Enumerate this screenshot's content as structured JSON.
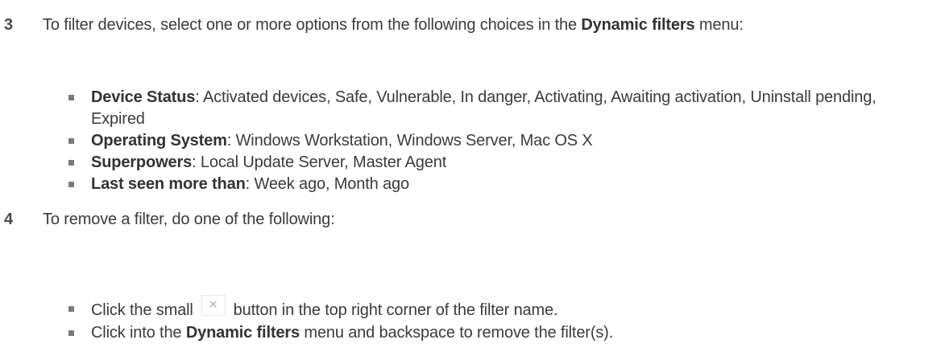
{
  "step3": {
    "number": "3",
    "intro_before": "To filter devices, select one or more options from the following choices in the ",
    "intro_bold": "Dynamic filters",
    "intro_after": " menu:",
    "bullets": [
      {
        "label": "Device Status",
        "text": ": Activated devices, Safe, Vulnerable, In danger, Activating, Awaiting activation, Uninstall pending, Expired"
      },
      {
        "label": "Operating System",
        "text": ": Windows Workstation, Windows Server, Mac OS X"
      },
      {
        "label": "Superpowers",
        "text": ": Local Update Server, Master Agent"
      },
      {
        "label": "Last seen more than",
        "text": ": Week ago, Month ago"
      }
    ]
  },
  "step4": {
    "number": "4",
    "intro": "To remove a filter, do one of the following:",
    "bullet1_before": "Click the small",
    "close_glyph": "×",
    "close_icon": "close-icon",
    "bullet1_after": "button in the top right corner of the filter name.",
    "bullet2_before": "Click into the ",
    "bullet2_bold": "Dynamic filters",
    "bullet2_after": " menu and backspace to remove the filter(s)."
  }
}
